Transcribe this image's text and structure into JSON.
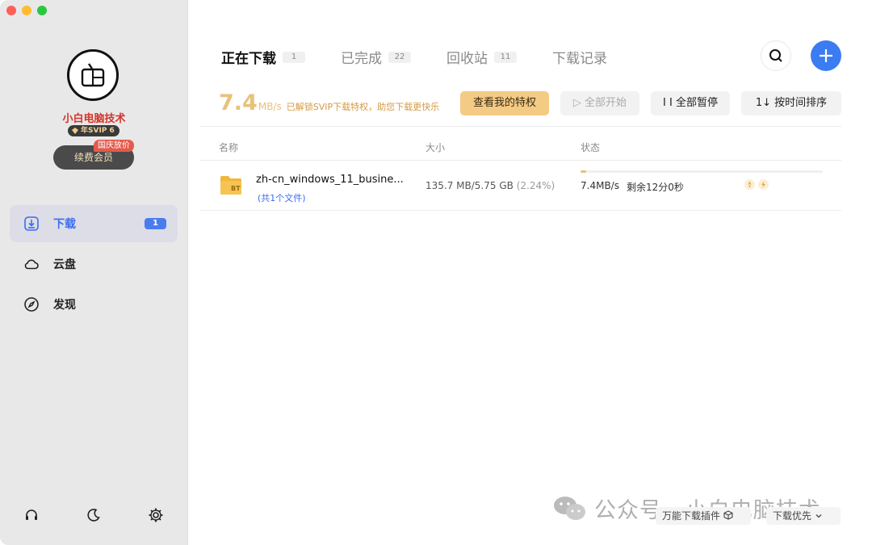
{
  "sidebar": {
    "profile": {
      "username": "小白电脑技术",
      "vip_level": "年SVIP 6",
      "promo_tag": "国庆放价",
      "renew_label": "续费会员"
    },
    "nav": [
      {
        "label": "下载",
        "badge": "1",
        "icon": "download-icon",
        "active": true
      },
      {
        "label": "云盘",
        "icon": "cloud-icon",
        "active": false
      },
      {
        "label": "发现",
        "icon": "compass-icon",
        "active": false
      }
    ],
    "bottom_icons": [
      "headset-icon",
      "moon-icon",
      "gear-icon"
    ]
  },
  "tabs": [
    {
      "label": "正在下载",
      "count": "1",
      "active": true
    },
    {
      "label": "已完成",
      "count": "22",
      "active": false
    },
    {
      "label": "回收站",
      "count": "11",
      "active": false
    },
    {
      "label": "下载记录",
      "active": false
    }
  ],
  "speed": {
    "value": "7.4",
    "unit": "MB/s",
    "note": "已解锁SVIP下载特权，助您下载更快乐"
  },
  "toolbar": {
    "privilege_label": "查看我的特权",
    "start_all_label": "▷ 全部开始",
    "pause_all_label": "I I 全部暂停",
    "sort_label": "1↓ 按时间排序"
  },
  "columns": {
    "name": "名称",
    "size": "大小",
    "status": "状态"
  },
  "downloads": [
    {
      "icon_text": "BT",
      "name": "zh-cn_windows_11_busine...",
      "sub": "(共1个文件)",
      "size": "135.7 MB/5.75 GB",
      "percent": "(2.24%)",
      "progress": 0.0224,
      "rate": "7.4MB/s",
      "remaining": "剩余12分0秒"
    }
  ],
  "footer": {
    "plugin_label": "万能下载插件",
    "priority_label": "下载优先"
  },
  "watermark": "公众号 · 小白电脑技术",
  "colors": {
    "accent": "#3c7cf2",
    "gold": "#e8c27a",
    "username_red": "#d4332a"
  }
}
